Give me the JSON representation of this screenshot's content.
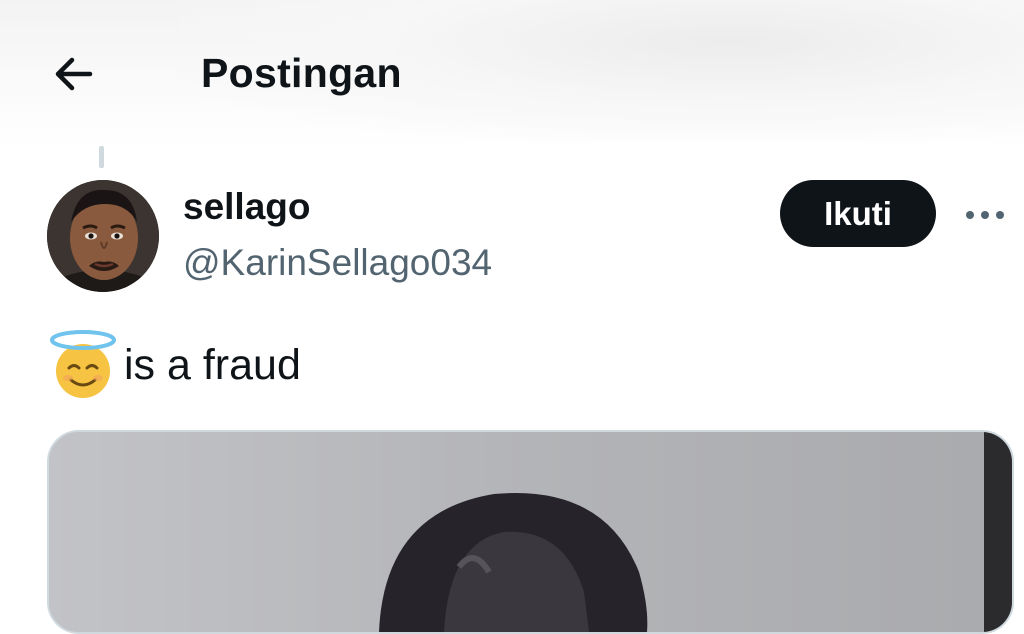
{
  "header": {
    "title": "Postingan",
    "back_icon": "arrow-left-icon"
  },
  "post": {
    "author": {
      "display_name": "sellago",
      "handle": "@KarinSellago034",
      "avatar": "avatar-photo"
    },
    "follow_label": "Ikuti",
    "more_icon": "more-horizontal-icon",
    "text": "is a fraud",
    "text_emoji": "smiling-face-with-halo-emoji",
    "media": "photo-attachment"
  },
  "colors": {
    "text_primary": "#0f1419",
    "text_secondary": "#536471",
    "button_bg": "#0f1419",
    "border": "#cfd9de"
  }
}
